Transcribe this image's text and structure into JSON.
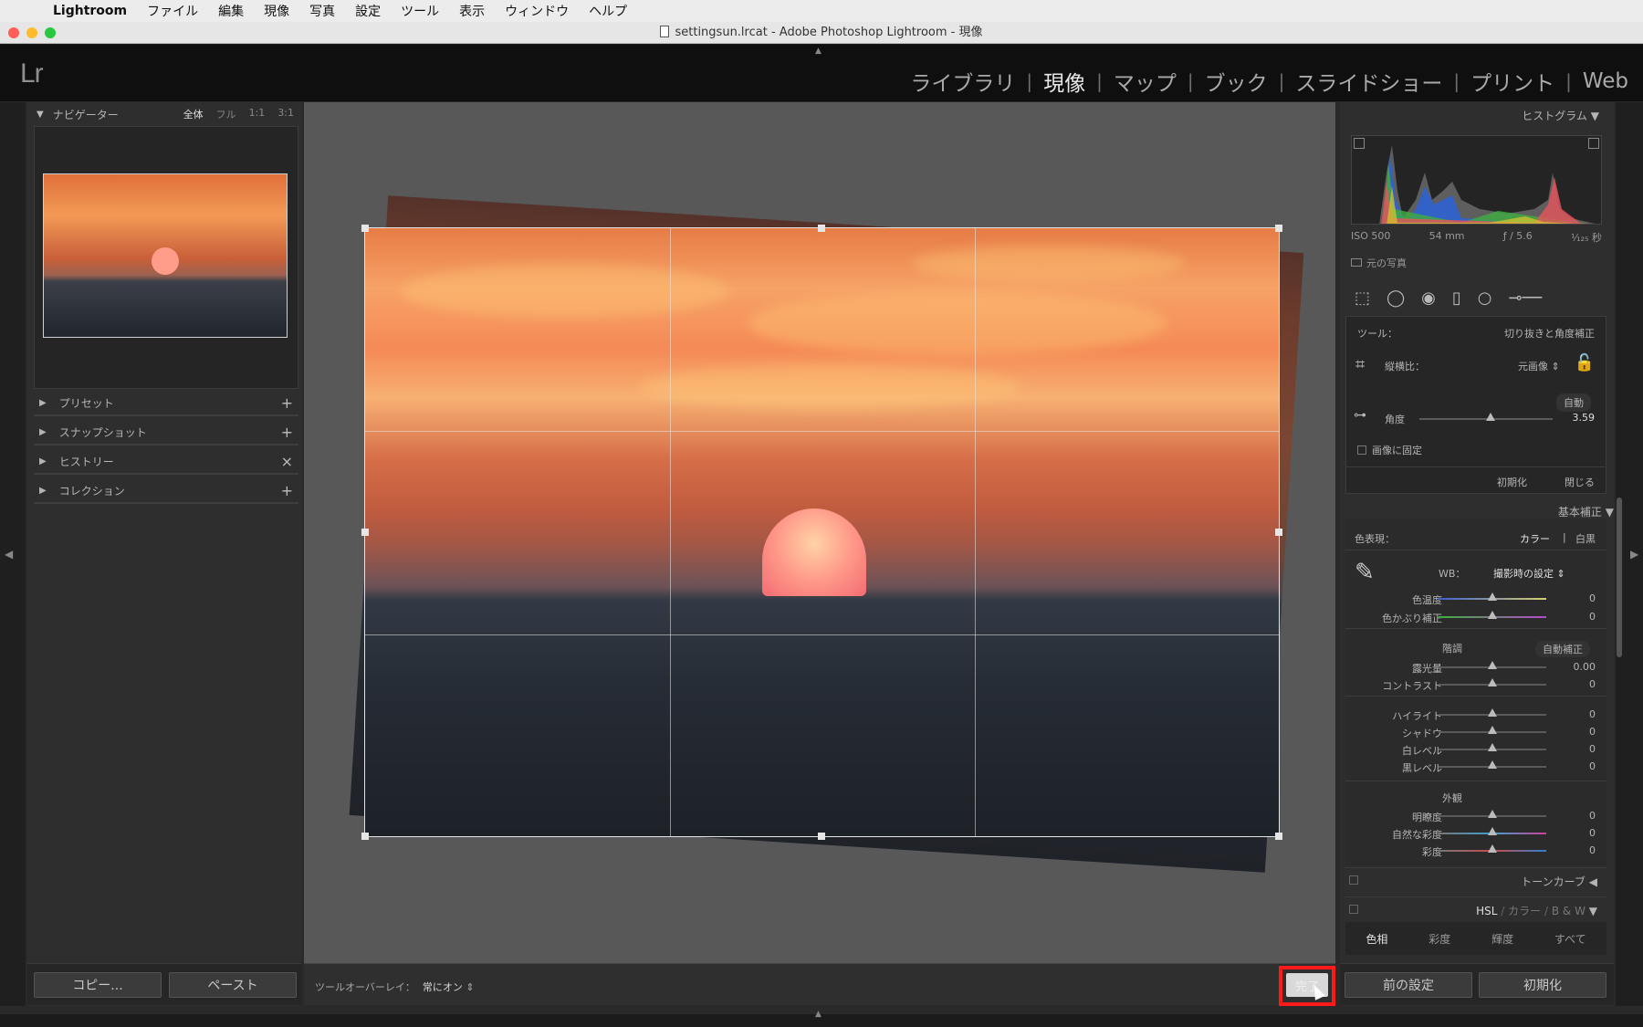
{
  "menubar": {
    "app": "Lightroom",
    "items": [
      "ファイル",
      "編集",
      "現像",
      "写真",
      "設定",
      "ツール",
      "表示",
      "ウィンドウ",
      "ヘルプ"
    ]
  },
  "window": {
    "title": "settingsun.lrcat - Adobe Photoshop Lightroom - 現像"
  },
  "header": {
    "logo": "Lr",
    "modules": [
      {
        "label": "ライブラリ",
        "active": false
      },
      {
        "label": "現像",
        "active": true
      },
      {
        "label": "マップ",
        "active": false
      },
      {
        "label": "ブック",
        "active": false
      },
      {
        "label": "スライドショー",
        "active": false
      },
      {
        "label": "プリント",
        "active": false
      },
      {
        "label": "Web",
        "active": false
      }
    ],
    "separator": "|"
  },
  "left_panel": {
    "navigator": {
      "title": "ナビゲーター",
      "zoom": [
        "全体",
        "フル",
        "1:1",
        "3:1"
      ]
    },
    "sections": [
      {
        "label": "プリセット",
        "action": "+"
      },
      {
        "label": "スナップショット",
        "action": "+"
      },
      {
        "label": "ヒストリー",
        "action": "×"
      },
      {
        "label": "コレクション",
        "action": "+"
      }
    ],
    "copy_label": "コピー...",
    "paste_label": "ペースト"
  },
  "toolbar": {
    "overlay_label": "ツールオーバーレイ：",
    "overlay_value": "常にオン",
    "done_label": "完了"
  },
  "right_panel": {
    "histogram": {
      "title": "ヒストグラム",
      "iso": "ISO 500",
      "focal": "54 mm",
      "aperture": "ƒ / 5.6",
      "shutter": "¹⁄₁₂₅ 秒",
      "original_photo": "元の写真"
    },
    "crop": {
      "tool_label": "ツール：",
      "tool_name": "切り抜きと角度補正",
      "aspect_label": "縦横比：",
      "aspect_value": "元画像",
      "auto_label": "自動",
      "angle_label": "角度",
      "angle_value": "3.59",
      "constrain_label": "画像に固定",
      "reset_label": "初期化",
      "close_label": "閉じる"
    },
    "basic": {
      "title": "基本補正",
      "treatment_label": "色表現：",
      "color_label": "カラー",
      "bw_label": "白黒",
      "wb_label": "WB：",
      "wb_value": "撮影時の設定",
      "tone_label": "階調",
      "auto_tone_label": "自動補正",
      "presence_label": "外観",
      "sliders": [
        {
          "label": "色温度",
          "value": "0"
        },
        {
          "label": "色かぶり補正",
          "value": "0"
        },
        {
          "label": "露光量",
          "value": "0.00"
        },
        {
          "label": "コントラスト",
          "value": "0"
        },
        {
          "label": "ハイライト",
          "value": "0"
        },
        {
          "label": "シャドウ",
          "value": "0"
        },
        {
          "label": "白レベル",
          "value": "0"
        },
        {
          "label": "黒レベル",
          "value": "0"
        },
        {
          "label": "明瞭度",
          "value": "0"
        },
        {
          "label": "自然な彩度",
          "value": "0"
        },
        {
          "label": "彩度",
          "value": "0"
        }
      ]
    },
    "tone_curve": {
      "title": "トーンカーブ"
    },
    "hsl": {
      "title_hsl": "HSL",
      "title_color": "カラー",
      "title_bw": "B & W",
      "tabs": [
        "色相",
        "彩度",
        "輝度",
        "すべて"
      ]
    },
    "prev_label": "前の設定",
    "reset_label": "初期化"
  }
}
